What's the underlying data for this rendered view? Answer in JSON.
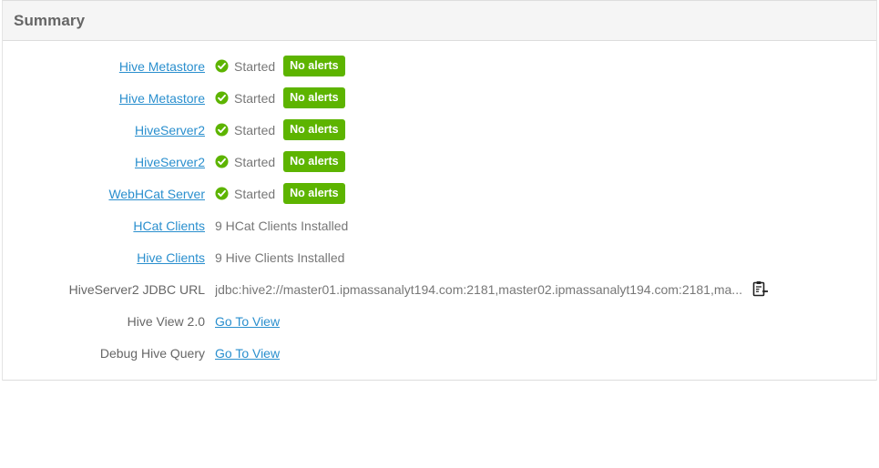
{
  "panel": {
    "title": "Summary"
  },
  "colors": {
    "link": "#2a8fce",
    "badge_green": "#5db400",
    "status_ok_green": "#5db400",
    "header_bg": "#f5f5f5",
    "text_gray": "#666666"
  },
  "rows": [
    {
      "label": "Hive Metastore",
      "label_is_link": true,
      "type": "status",
      "status_icon": "check-circle-icon",
      "status_text": "Started",
      "badge": "No alerts"
    },
    {
      "label": "Hive Metastore",
      "label_is_link": true,
      "type": "status",
      "status_icon": "check-circle-icon",
      "status_text": "Started",
      "badge": "No alerts"
    },
    {
      "label": "HiveServer2",
      "label_is_link": true,
      "type": "status",
      "status_icon": "check-circle-icon",
      "status_text": "Started",
      "badge": "No alerts"
    },
    {
      "label": "HiveServer2",
      "label_is_link": true,
      "type": "status",
      "status_icon": "check-circle-icon",
      "status_text": "Started",
      "badge": "No alerts"
    },
    {
      "label": "WebHCat Server",
      "label_is_link": true,
      "type": "status",
      "status_icon": "check-circle-icon",
      "status_text": "Started",
      "badge": "No alerts"
    },
    {
      "label": "HCat Clients",
      "label_is_link": true,
      "type": "text",
      "value": "9 HCat Clients Installed"
    },
    {
      "label": "Hive Clients",
      "label_is_link": true,
      "type": "text",
      "value": "9 Hive Clients Installed"
    },
    {
      "label": "HiveServer2 JDBC URL",
      "label_is_link": false,
      "type": "jdbc",
      "value": "jdbc:hive2://master01.ipmassanalyt194.com:2181,master02.ipmassanalyt194.com:2181,ma...",
      "copy_icon": "copy-to-clipboard-icon"
    },
    {
      "label": "Hive View 2.0",
      "label_is_link": false,
      "type": "link",
      "value": "Go To View"
    },
    {
      "label": "Debug Hive Query",
      "label_is_link": false,
      "type": "link",
      "value": "Go To View"
    }
  ]
}
